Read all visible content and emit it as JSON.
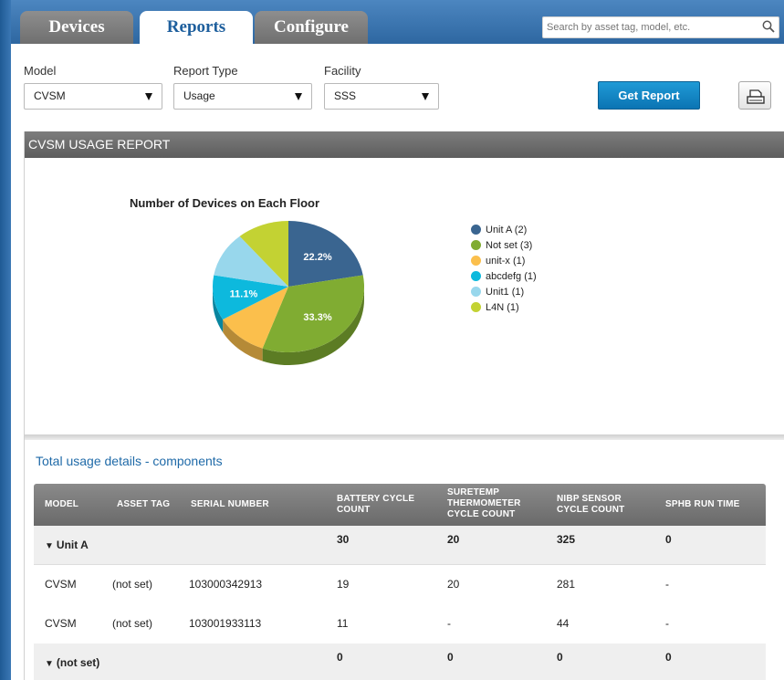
{
  "tabs": [
    {
      "label": "Devices",
      "active": false
    },
    {
      "label": "Reports",
      "active": true
    },
    {
      "label": "Configure",
      "active": false
    }
  ],
  "search": {
    "placeholder": "Search by asset tag, model, etc."
  },
  "filters": {
    "model": {
      "label": "Model",
      "value": "CVSM"
    },
    "report_type": {
      "label": "Report Type",
      "value": "Usage"
    },
    "facility": {
      "label": "Facility",
      "value": "SSS"
    }
  },
  "actions": {
    "get_report": "Get Report",
    "print_icon": "printer-icon"
  },
  "report": {
    "title": "CVSM USAGE REPORT",
    "details_title": "Total usage details - components"
  },
  "chart_data": {
    "type": "pie",
    "title": "Number of Devices on Each Floor",
    "legend_position": "right",
    "slices": [
      {
        "label": "Unit A (2)",
        "value": 2,
        "percent_label": "22.2%",
        "color": "#3a6590"
      },
      {
        "label": "Not set (3)",
        "value": 3,
        "percent_label": "33.3%",
        "color": "#80ac32"
      },
      {
        "label": "unit-x (1)",
        "value": 1,
        "percent_label": "",
        "color": "#fbbf4c"
      },
      {
        "label": "abcdefg (1)",
        "value": 1,
        "percent_label": "11.1%",
        "color": "#0db9dd"
      },
      {
        "label": "Unit1 (1)",
        "value": 1,
        "percent_label": "",
        "color": "#98d7ec"
      },
      {
        "label": "L4N (1)",
        "value": 1,
        "percent_label": "",
        "color": "#c3d233"
      }
    ]
  },
  "table": {
    "headers": [
      "MODEL",
      "ASSET TAG",
      "SERIAL NUMBER",
      "BATTERY CYCLE COUNT",
      "SURETEMP THERMOMETER CYCLE COUNT",
      "NIBP SENSOR CYCLE COUNT",
      "SPHB RUN TIME"
    ],
    "groups": [
      {
        "name": "Unit A",
        "totals": [
          "30",
          "20",
          "325",
          "0"
        ],
        "rows": [
          {
            "model": "CVSM",
            "asset_tag": "(not set)",
            "serial": "103000342913",
            "values": [
              "19",
              "20",
              "281",
              "-"
            ]
          },
          {
            "model": "CVSM",
            "asset_tag": "(not set)",
            "serial": "103001933113",
            "values": [
              "11",
              "-",
              "44",
              "-"
            ]
          }
        ]
      },
      {
        "name": "(not set)",
        "totals": [
          "0",
          "0",
          "0",
          "0"
        ],
        "rows": []
      }
    ]
  }
}
